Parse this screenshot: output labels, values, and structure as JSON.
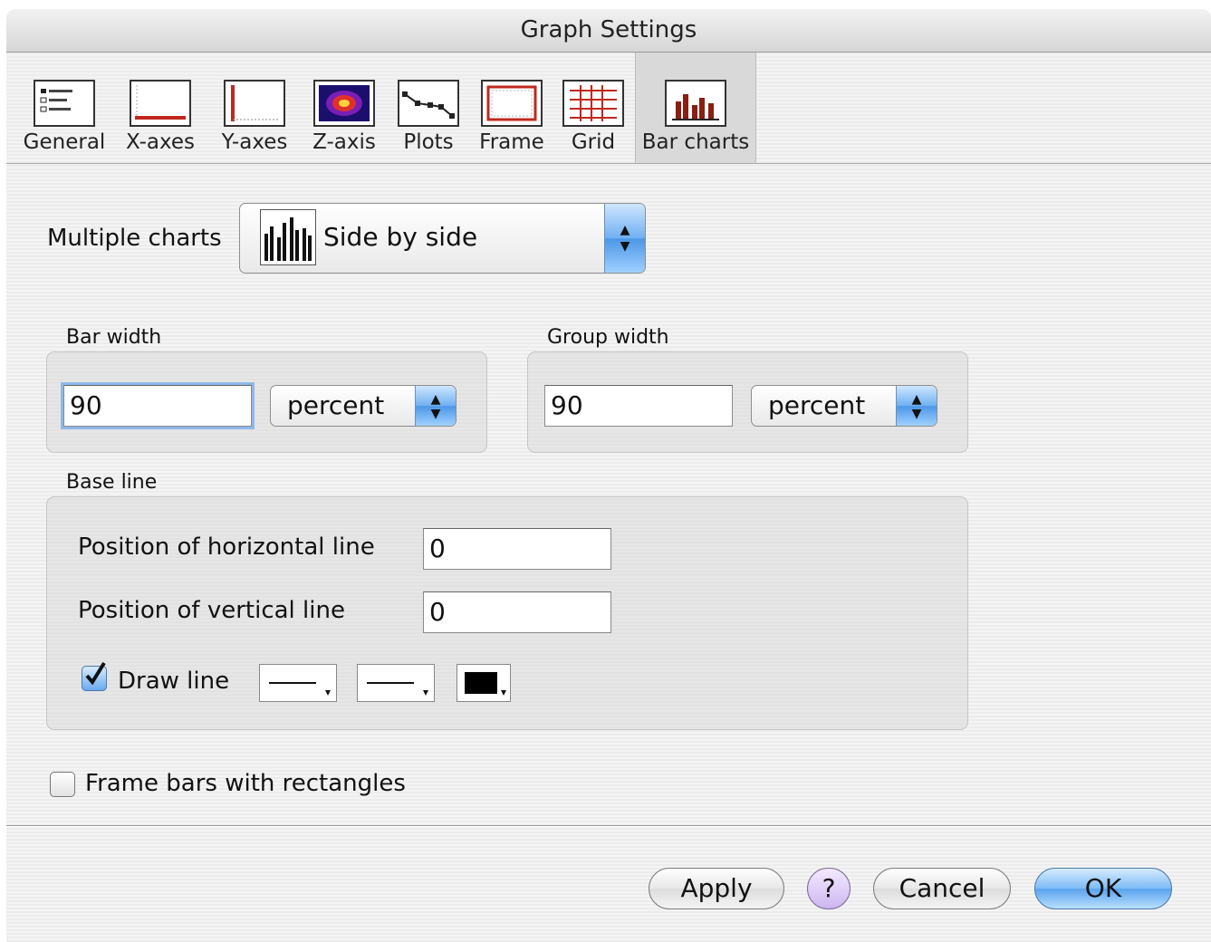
{
  "window": {
    "title": "Graph Settings"
  },
  "toolbar": {
    "tabs": [
      {
        "label": "General",
        "icon": "general-icon"
      },
      {
        "label": "X-axes",
        "icon": "x-axes-icon"
      },
      {
        "label": "Y-axes",
        "icon": "y-axes-icon"
      },
      {
        "label": "Z-axis",
        "icon": "z-axis-icon"
      },
      {
        "label": "Plots",
        "icon": "plots-icon"
      },
      {
        "label": "Frame",
        "icon": "frame-icon"
      },
      {
        "label": "Grid",
        "icon": "grid-icon"
      },
      {
        "label": "Bar charts",
        "icon": "bar-charts-icon"
      }
    ],
    "selected": "Bar charts"
  },
  "multiple_charts": {
    "label": "Multiple charts",
    "value": "Side by side"
  },
  "bar_width": {
    "label": "Bar width",
    "value": "90",
    "unit": "percent"
  },
  "group_width": {
    "label": "Group width",
    "value": "90",
    "unit": "percent"
  },
  "base_line": {
    "label": "Base line",
    "horizontal_label": "Position of horizontal line",
    "horizontal_value": "0",
    "vertical_label": "Position of vertical line",
    "vertical_value": "0",
    "draw_line_label": "Draw line",
    "draw_line_checked": true
  },
  "frame_bars": {
    "label": "Frame bars with rectangles",
    "checked": false
  },
  "buttons": {
    "apply": "Apply",
    "help": "?",
    "cancel": "Cancel",
    "ok": "OK"
  },
  "colors": {
    "accent": "#5aa2ee",
    "line_color": "#000000"
  }
}
